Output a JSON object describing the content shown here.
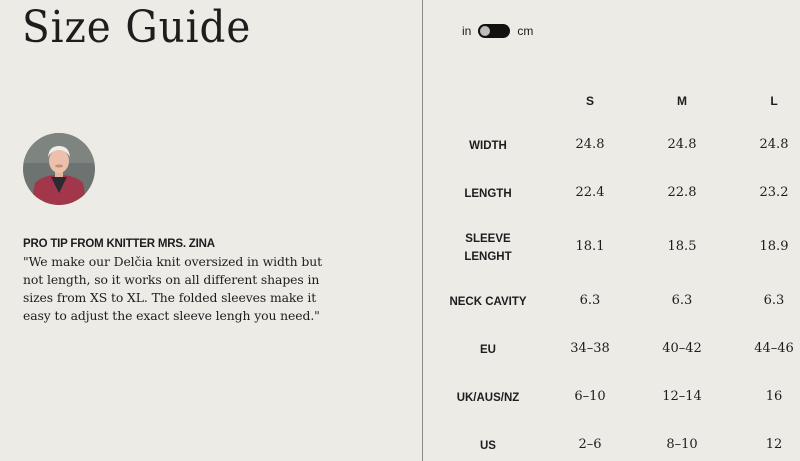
{
  "title": "Size Guide",
  "unit_toggle": {
    "left_label": "in",
    "right_label": "cm"
  },
  "tip": {
    "heading": "PRO TIP FROM KNITTER MRS. ZINA",
    "lines": [
      "\"We make our Delčia knit oversized in width but",
      "not length, so it works on all different shapes in",
      "sizes from XS to XL. The folded sleeves make it",
      "easy to adjust the exact sleeve lengh you need.\""
    ]
  },
  "sizes": [
    "S",
    "M",
    "L"
  ],
  "rows": [
    {
      "label": "WIDTH",
      "values": [
        "24.8",
        "24.8",
        "24.8"
      ]
    },
    {
      "label": "LENGTH",
      "values": [
        "22.4",
        "22.8",
        "23.2"
      ]
    },
    {
      "label": "SLEEVE LENGHT",
      "label_lines": [
        "SLEEVE",
        "LENGHT"
      ],
      "values": [
        "18.1",
        "18.5",
        "18.9"
      ]
    },
    {
      "label": "NECK CAVITY",
      "values": [
        "6.3",
        "6.3",
        "6.3"
      ]
    },
    {
      "label": "EU",
      "values": [
        "34–38",
        "40–42",
        "44–46"
      ]
    },
    {
      "label": "UK/AUS/NZ",
      "values": [
        "6–10",
        "12–14",
        "16"
      ]
    },
    {
      "label": "US",
      "values": [
        "2–6",
        "8–10",
        "12"
      ]
    }
  ]
}
